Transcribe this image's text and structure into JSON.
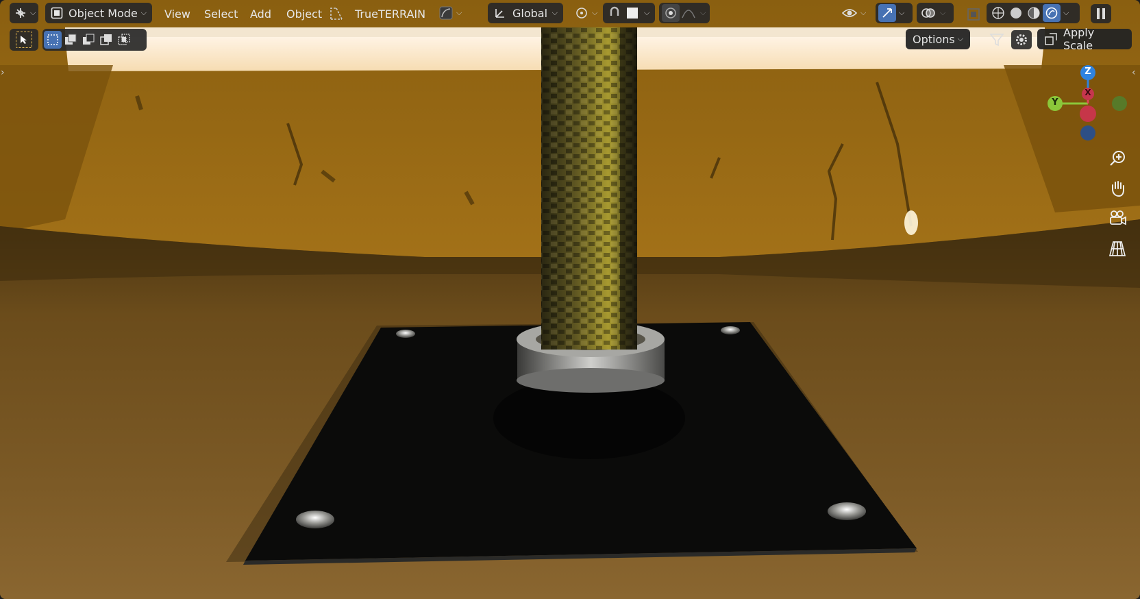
{
  "header": {
    "editor_type_icon": "3d-viewport-icon",
    "mode_label": "Object Mode",
    "menus": [
      "View",
      "Select",
      "Add",
      "Object"
    ],
    "addon_label": "TrueTERRAIN",
    "transform_orientation": "Global"
  },
  "toolbar": {
    "options_label": "Options",
    "apply_scale_label": "Apply Scale"
  },
  "gizmo": {
    "z_label": "Z",
    "y_label": "Y",
    "x_label": "X"
  },
  "colors": {
    "accent": "#4772b3",
    "axis_x": "#e2455a",
    "axis_y": "#8bc73a",
    "axis_z": "#2f83e0",
    "scene_wall": "#9a6a14",
    "scene_floor": "#6e4d1a"
  }
}
